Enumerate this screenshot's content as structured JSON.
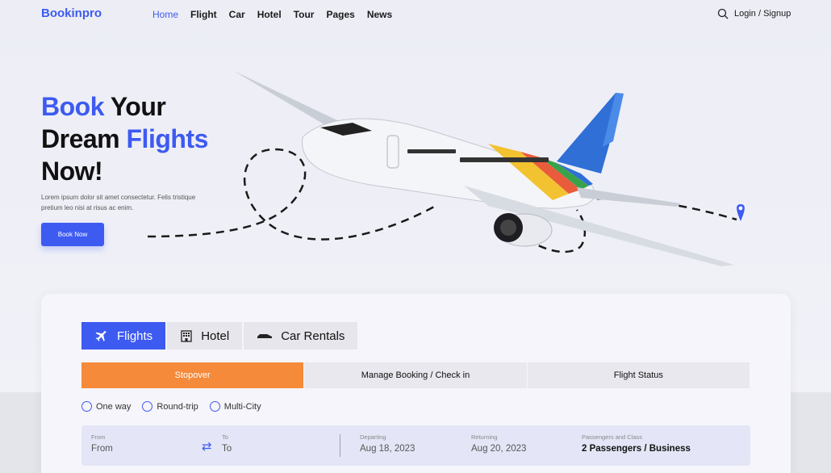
{
  "brand": {
    "logo": "Bookinpro",
    "accent": "#3d5af1",
    "secondary_accent": "#f58a3a"
  },
  "nav": {
    "items": [
      {
        "label": "Home",
        "active": true
      },
      {
        "label": "Flight"
      },
      {
        "label": "Car"
      },
      {
        "label": "Hotel"
      },
      {
        "label": "Tour"
      },
      {
        "label": "Pages"
      },
      {
        "label": "News"
      }
    ],
    "search_icon": "search-icon",
    "login": "Login / Signup"
  },
  "hero": {
    "line1_blue": "Book",
    "line1_rest": " Your",
    "line2_dark": "Dream ",
    "line2_blue": "Flights",
    "line3": "Now!",
    "description": "Lorem ipsum dolor sit amet consectetur. Felis tristique pretium leo nisi at risus ac enim.",
    "cta": "Book Now"
  },
  "booking": {
    "tabs": [
      {
        "label": "Flights",
        "icon": "airplane-icon",
        "active": true
      },
      {
        "label": "Hotel",
        "icon": "building-icon"
      },
      {
        "label": "Car Rentals",
        "icon": "car-icon"
      }
    ],
    "subtabs": [
      {
        "label": "Stopover",
        "active": true
      },
      {
        "label": "Manage Booking / Check in"
      },
      {
        "label": "Flight Status"
      }
    ],
    "trip_types": [
      "One way",
      "Round-trip",
      "Multi-City"
    ],
    "fields": {
      "from_label": "From",
      "from_value": "From",
      "to_label": "To",
      "to_value": "To",
      "departing_label": "Departing",
      "departing_value": "Aug 18, 2023",
      "returning_label": "Returning",
      "returning_value": "Aug 20, 2023",
      "passengers_label": "Passengers and Class",
      "passengers_value": "2 Passengers / Business"
    }
  }
}
